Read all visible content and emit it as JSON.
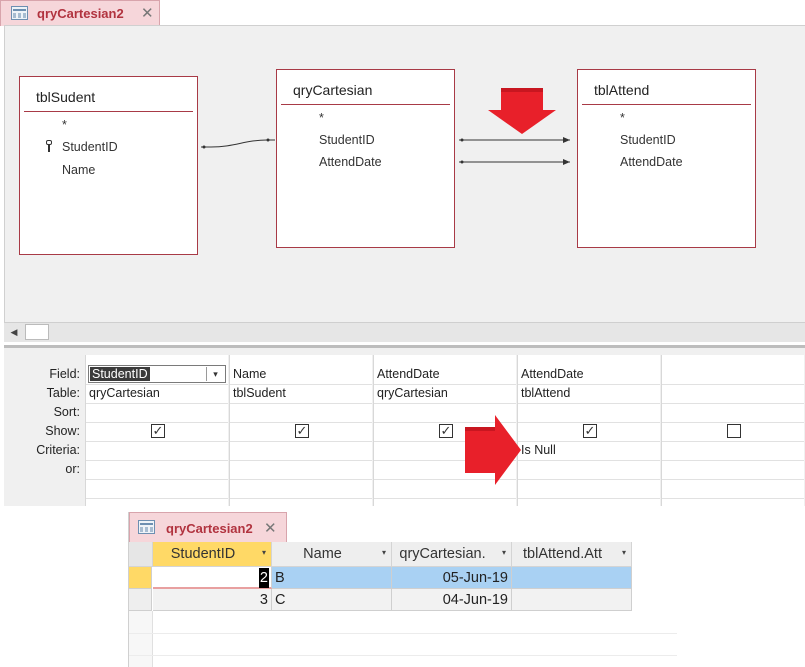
{
  "design_tab": {
    "title": "qryCartesian2",
    "close": "✕"
  },
  "tables": [
    {
      "name": "tblSudent",
      "fields": [
        "*",
        "StudentID",
        "Name"
      ]
    },
    {
      "name": "qryCartesian",
      "fields": [
        "*",
        "StudentID",
        "AttendDate"
      ]
    },
    {
      "name": "tblAttend",
      "fields": [
        "*",
        "StudentID",
        "AttendDate"
      ]
    }
  ],
  "qbe": {
    "row_labels": [
      "Field:",
      "Table:",
      "Sort:",
      "Show:",
      "Criteria:",
      "or:"
    ],
    "columns": [
      {
        "field": "StudentID",
        "table": "qryCartesian",
        "show": true,
        "criteria": ""
      },
      {
        "field": "Name",
        "table": "tblSudent",
        "show": true,
        "criteria": ""
      },
      {
        "field": "AttendDate",
        "table": "qryCartesian",
        "show": true,
        "criteria": ""
      },
      {
        "field": "AttendDate",
        "table": "tblAttend",
        "show": true,
        "criteria": "Is Null"
      },
      {
        "field": "",
        "table": "",
        "show": false,
        "criteria": ""
      }
    ],
    "check_mark": "✓"
  },
  "datasheet": {
    "tab_title": "qryCartesian2",
    "close": "✕",
    "headers": [
      "StudentID",
      "Name",
      "qryCartesian.",
      "tblAttend.Att"
    ],
    "rows": [
      {
        "student_id": "2",
        "name": "B",
        "date": "05-Jun-19",
        "attend": ""
      },
      {
        "student_id": "3",
        "name": "C",
        "date": "04-Jun-19",
        "attend": ""
      }
    ]
  },
  "colors": {
    "accent": "#b1333f",
    "arrow_red": "#e8202a",
    "header_highlight": "#ffd966",
    "row_select": "#a9d1f3"
  },
  "icons": {
    "dropdown": "▾",
    "sort": "▾",
    "scroll_left": "◀"
  }
}
